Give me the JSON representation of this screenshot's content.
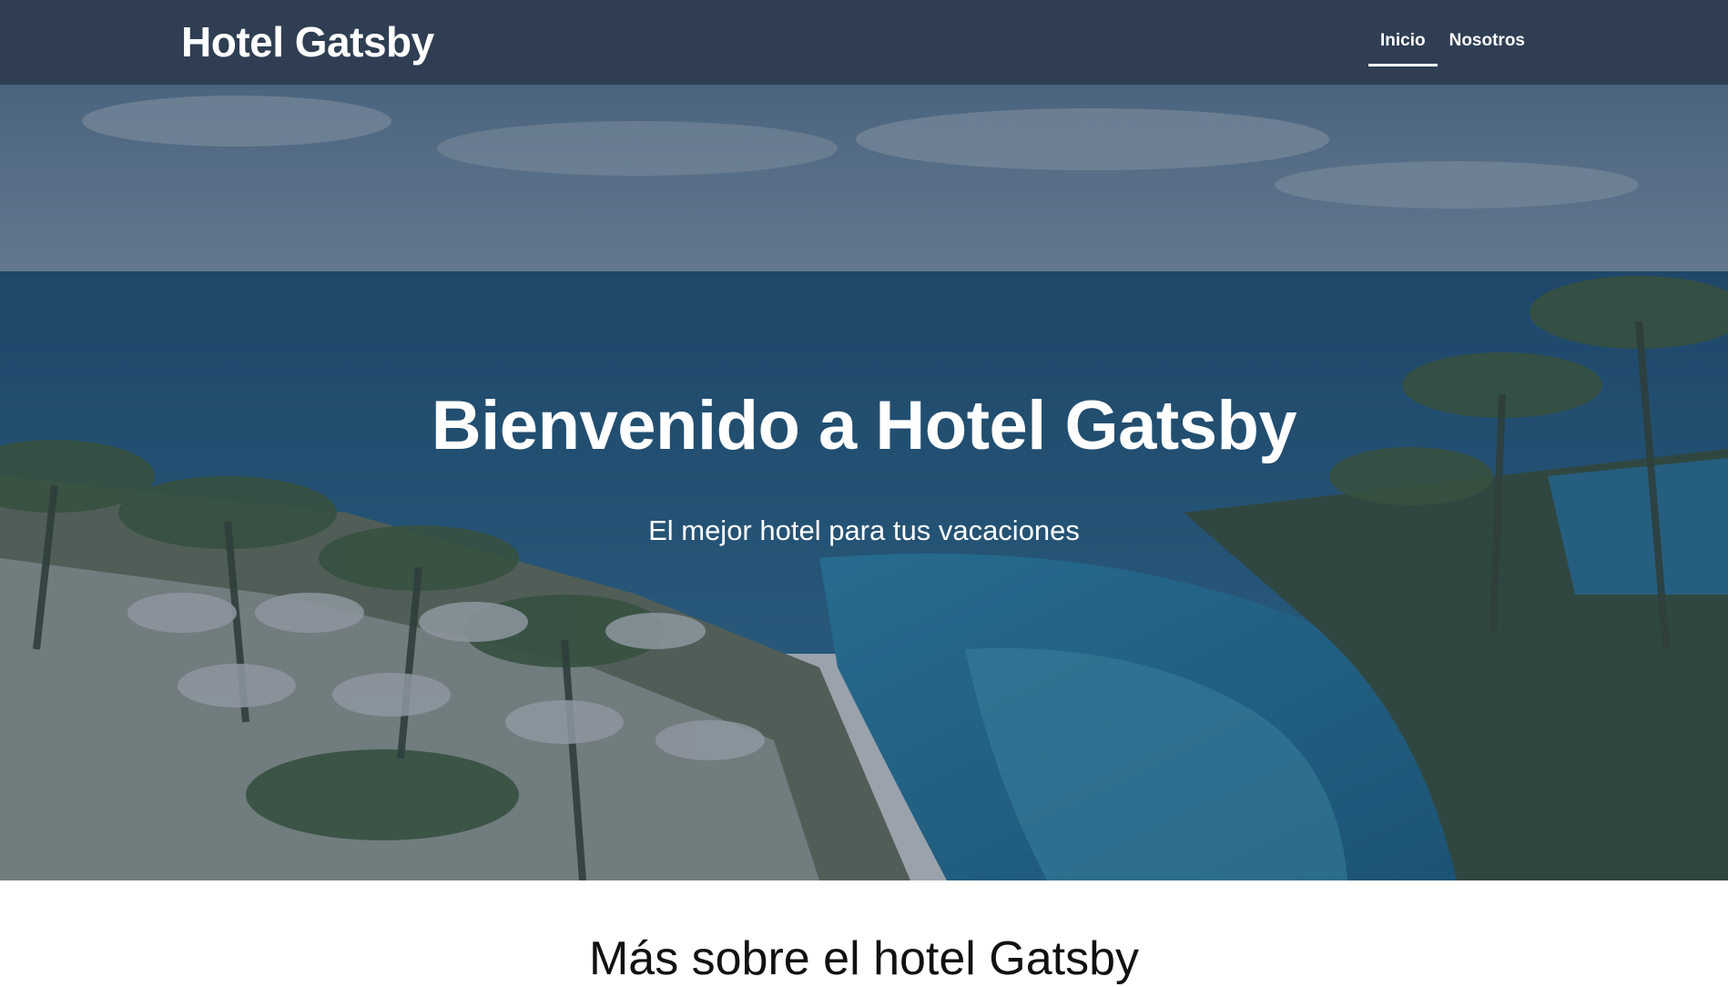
{
  "header": {
    "logo": "Hotel Gatsby",
    "nav": [
      {
        "label": "Inicio",
        "active": true
      },
      {
        "label": "Nosotros",
        "active": false
      }
    ]
  },
  "hero": {
    "title": "Bienvenido a Hotel Gatsby",
    "subtitle": "El mejor hotel para tus vacaciones",
    "background_image": "resort-pool-ocean-palms-photo"
  },
  "content": {
    "section_title": "Más sobre el hotel Gatsby"
  },
  "colors": {
    "header_bg": "#2f3e52",
    "hero_overlay": "#1e3048",
    "text_light": "#ffffff",
    "text_dark": "#111111"
  }
}
